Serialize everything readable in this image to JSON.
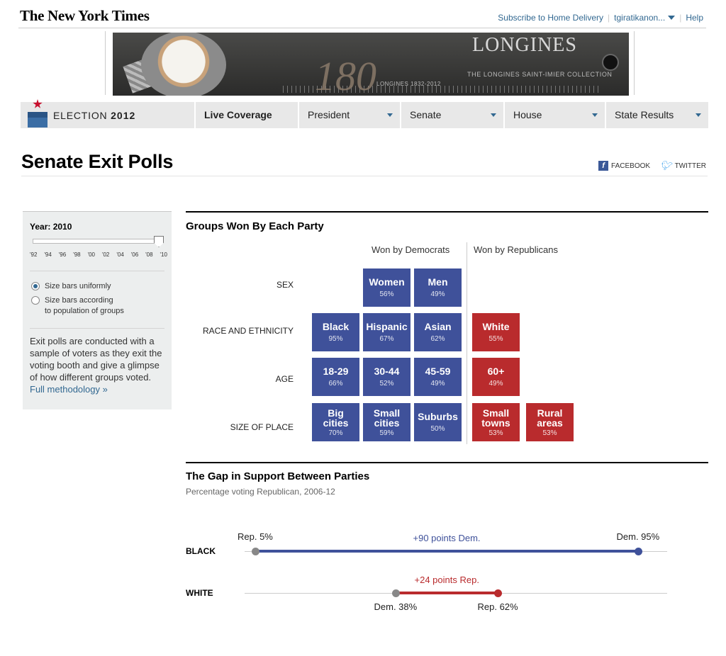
{
  "header": {
    "masthead": "The New York Times",
    "subscribe": "Subscribe to Home Delivery",
    "user": "tgiratikanon...",
    "help": "Help"
  },
  "ad": {
    "brand": "LONGINES",
    "anniversary": "180",
    "years": "LONGINES 1832-2012",
    "collection": "THE LONGINES SAINT-IMIER COLLECTION"
  },
  "nav": {
    "section_label": "ELECTION",
    "section_year": "2012",
    "items": [
      {
        "label": "Live Coverage"
      },
      {
        "label": "President"
      },
      {
        "label": "Senate"
      },
      {
        "label": "House"
      },
      {
        "label": "State Results"
      }
    ]
  },
  "page": {
    "title": "Senate Exit Polls",
    "facebook": "FACEBOOK",
    "twitter": "TWITTER"
  },
  "sidebar": {
    "year_label": "Year: 2010",
    "selected_year": "'10",
    "years": [
      "'92",
      "'94",
      "'96",
      "'98",
      "'00",
      "'02",
      "'04",
      "'06",
      "'08",
      "'10"
    ],
    "option_uniform": "Size bars uniformly",
    "option_population_1": "Size bars according",
    "option_population_2": "to population of groups",
    "description": "Exit polls are conducted with a sample of voters as they exit the voting booth and give a glimpse of how different groups voted.",
    "link": "Full methodology »"
  },
  "groups": {
    "title": "Groups Won By Each Party",
    "won_dem": "Won by Democrats",
    "won_rep": "Won by Republicans",
    "rows": [
      {
        "label": "SEX"
      },
      {
        "label": "RACE AND ETHNICITY"
      },
      {
        "label": "AGE"
      },
      {
        "label": "SIZE OF PLACE"
      }
    ],
    "colors": {
      "dem": "#3f519a",
      "rep": "#b92b2d"
    },
    "tiles": {
      "women": {
        "name": "Women",
        "pct": "56%"
      },
      "men": {
        "name": "Men",
        "pct": "49%"
      },
      "black": {
        "name": "Black",
        "pct": "95%"
      },
      "hispanic": {
        "name": "Hispanic",
        "pct": "67%"
      },
      "asian": {
        "name": "Asian",
        "pct": "62%"
      },
      "white": {
        "name": "White",
        "pct": "55%"
      },
      "age1829": {
        "name": "18-29",
        "pct": "66%"
      },
      "age3044": {
        "name": "30-44",
        "pct": "52%"
      },
      "age4559": {
        "name": "45-59",
        "pct": "49%"
      },
      "age60": {
        "name": "60+",
        "pct": "49%"
      },
      "bigcities": {
        "name1": "Big",
        "name2": "cities",
        "pct": "70%"
      },
      "smallcities": {
        "name1": "Small",
        "name2": "cities",
        "pct": "59%"
      },
      "suburbs": {
        "name": "Suburbs",
        "pct": "50%"
      },
      "smalltowns": {
        "name1": "Small",
        "name2": "towns",
        "pct": "53%"
      },
      "rural": {
        "name1": "Rural",
        "name2": "areas",
        "pct": "53%"
      }
    }
  },
  "gap": {
    "title": "The Gap in Support Between Parties",
    "subtitle": "Percentage voting Republican, 2006-12",
    "rows": [
      {
        "label": "BLACK",
        "rep_pct": 5,
        "dem_pct": 95,
        "rep_text": "Rep. 5%",
        "dem_text": "Dem. 95%",
        "gap_text": "+90 points Dem."
      },
      {
        "label": "WHITE",
        "dem_pct": 38,
        "rep_pct": 62,
        "dem_text": "Dem. 38%",
        "rep_text": "Rep. 62%",
        "gap_text": "+24 points Rep."
      }
    ]
  }
}
